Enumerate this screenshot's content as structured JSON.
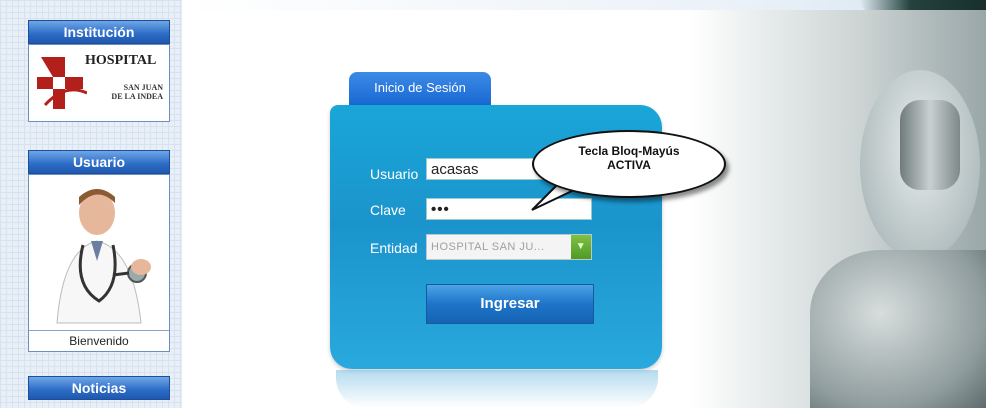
{
  "sidebar": {
    "institucion_header": "Institución",
    "hospital_logo": {
      "title": "HOSPITAL",
      "subtitle_line1": "SAN JUAN",
      "subtitle_line2": "DE LA INDEA"
    },
    "usuario_header": "Usuario",
    "welcome_text": "Bienvenido",
    "noticias_header": "Noticias"
  },
  "login": {
    "tab_label": "Inicio de Sesión",
    "usuario_label": "Usuario",
    "usuario_value": "acasas",
    "clave_label": "Clave",
    "clave_value": "•••",
    "entidad_label": "Entidad",
    "entidad_value": "HOSPITAL SAN JU...",
    "submit_label": "Ingresar"
  },
  "caps_warning": {
    "line1": "Tecla Bloq-Mayús",
    "line2": "ACTIVA"
  },
  "colors": {
    "card": "#1a9fd6",
    "header": "#2c6cc6",
    "select_arrow": "#5aa82c"
  },
  "icons": [
    "hospital-logo-icon",
    "user-photo-icon",
    "dropdown-arrow-icon"
  ]
}
